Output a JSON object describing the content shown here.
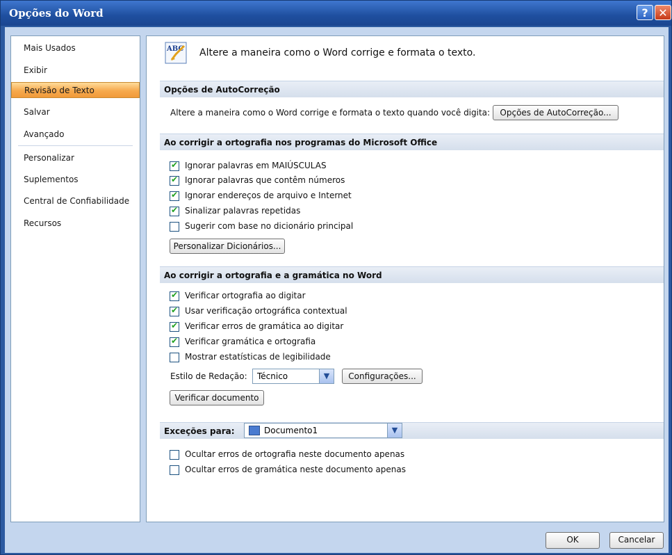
{
  "window": {
    "title": "Opções do Word",
    "help_glyph": "?",
    "close_glyph": "✕"
  },
  "sidebar": {
    "items": [
      {
        "label": "Mais Usados"
      },
      {
        "label": "Exibir"
      },
      {
        "label": "Revisão de Texto",
        "selected": true
      },
      {
        "label": "Salvar"
      },
      {
        "label": "Avançado"
      },
      {
        "label": "Personalizar"
      },
      {
        "label": "Suplementos"
      },
      {
        "label": "Central de Confiabilidade"
      },
      {
        "label": "Recursos"
      }
    ]
  },
  "content": {
    "header": "Altere a maneira como o Word corrige e formata o texto.",
    "icon_text": "ABC",
    "autocorrect": {
      "title": "Opções de AutoCorreção",
      "description": "Altere a maneira como o Word corrige e formata o texto quando você digita:",
      "button": "Opções de AutoCorreção..."
    },
    "office_spelling": {
      "title": "Ao corrigir a ortografia nos programas do Microsoft Office",
      "options": [
        {
          "label": "Ignorar palavras em MAIÚSCULAS",
          "checked": true
        },
        {
          "label": "Ignorar palavras que contêm números",
          "checked": true
        },
        {
          "label": "Ignorar endereços de arquivo e Internet",
          "checked": true
        },
        {
          "label": "Sinalizar palavras repetidas",
          "checked": true
        },
        {
          "label": "Sugerir com base no dicionário principal",
          "checked": false
        }
      ],
      "dict_button": "Personalizar Dicionários..."
    },
    "word_spelling": {
      "title": "Ao corrigir a ortografia e a gramática no Word",
      "options": [
        {
          "label": "Verificar ortografia ao digitar",
          "checked": true
        },
        {
          "label": "Usar verificação ortográfica contextual",
          "checked": true
        },
        {
          "label": "Verificar erros de gramática ao digitar",
          "checked": true
        },
        {
          "label": "Verificar gramática e ortografia",
          "checked": true
        },
        {
          "label": "Mostrar estatísticas de legibilidade",
          "checked": false
        }
      ],
      "style_label": "Estilo de Redação:",
      "style_value": "Técnico",
      "settings_button": "Configurações...",
      "check_button": "Verificar documento"
    },
    "exceptions": {
      "label": "Exceções para:",
      "document": "Documento1",
      "options": [
        {
          "label": "Ocultar erros de ortografia neste documento apenas",
          "checked": false
        },
        {
          "label": "Ocultar erros de gramática neste documento apenas",
          "checked": false
        }
      ]
    }
  },
  "footer": {
    "ok": "OK",
    "cancel": "Cancelar"
  }
}
